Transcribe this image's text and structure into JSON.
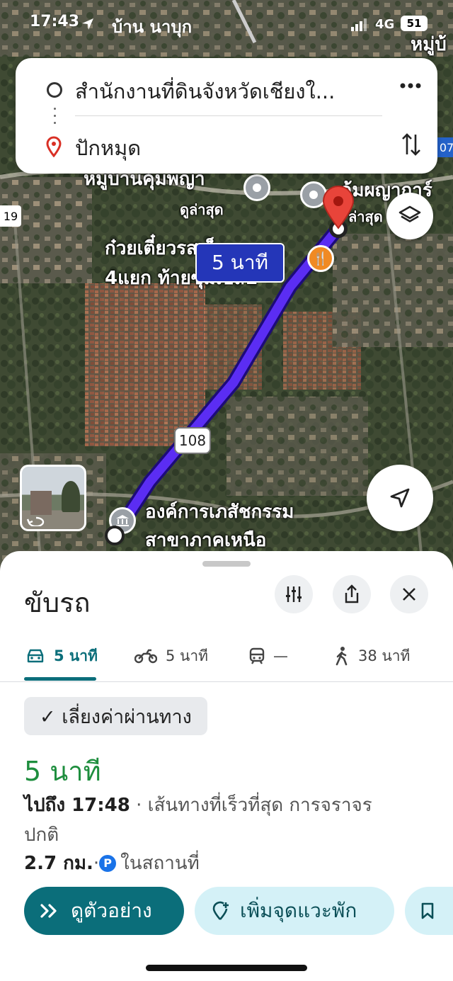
{
  "status_bar": {
    "time": "17:43",
    "location_label": "บ้าน นาบุก",
    "network": "4G",
    "battery": "51"
  },
  "search": {
    "origin": "สำนักงานที่ดินจังหวัดเชียงใ...",
    "destination": "ปักหมุด",
    "more_icon": "ellipsis-icon",
    "swap_icon": "swap-vertical-icon"
  },
  "map": {
    "labels": {
      "top_right_1": "หมู่บ้",
      "top_left_partial": "จังหวัดเชียง",
      "village": "หมู่บ้านคุ้มพญา",
      "village_sub": "ดูล่าสุด",
      "right_place": "คุ้มผญาการ์",
      "right_place_sub": "ล่าสุด",
      "restaurant_1": "ก๋วยเตี๋ยวรสเด็ด",
      "restaurant_2": "4แยก ท้ายซุ้มเปล1",
      "org_1": "องค์การเภสัชกรรม",
      "org_2": "สาขาภาคเหนือ",
      "side_19": "19",
      "side_07": "07"
    },
    "route_badge": "5 นาที",
    "road_shield": "108",
    "route_color": "#5b2df3"
  },
  "sheet": {
    "title": "ขับรถ",
    "tabs": [
      {
        "icon": "car-icon",
        "label": "5 นาที",
        "active": true
      },
      {
        "icon": "motorcycle-icon",
        "label": "5 นาที",
        "active": false
      },
      {
        "icon": "transit-icon",
        "label": "—",
        "active": false
      },
      {
        "icon": "walk-icon",
        "label": "38 นาที",
        "active": false
      }
    ],
    "chip": "✓ เลี่ยงค่าผ่านทาง",
    "duration": "5 นาที",
    "arrival_line_bold": "ไปถึง 17:48",
    "arrival_line_rest": " · เส้นทางที่เร็วที่สุด การจราจร",
    "arrival_line_2": "ปกติ",
    "distance": "2.7 กม.",
    "parking_dot": " · ",
    "parking_label": "ในสถานที่",
    "preview_button": "ดูตัวอย่าง",
    "add_stop_button": "เพิ่มจุดแวะพัก",
    "accent_green": "#1e8e3e",
    "accent_teal": "#0b6e7a"
  }
}
